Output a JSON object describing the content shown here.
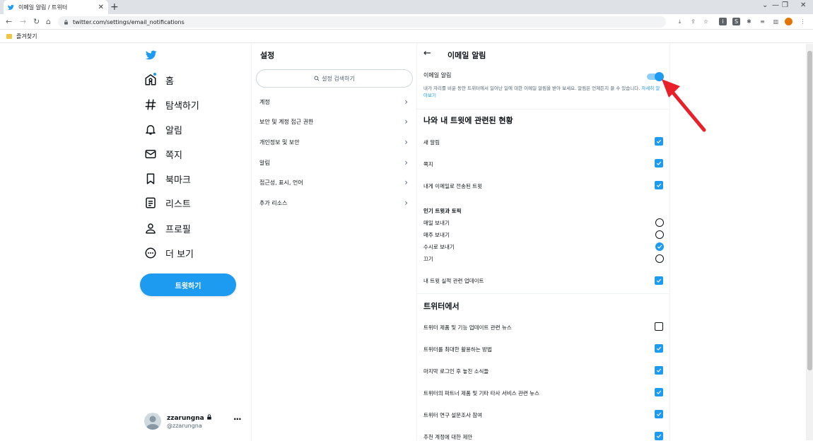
{
  "browser": {
    "tab_title": "이메일 알림 / 트위터",
    "tab_close": "✕",
    "new_tab": "+",
    "url": "twitter.com/settings/email_notifications",
    "bookmark_folder": "즐겨찾기",
    "window_controls": [
      "⌄",
      "—",
      "❐",
      "✕"
    ]
  },
  "nav": {
    "items": [
      {
        "label": "홈",
        "icon": "home-icon"
      },
      {
        "label": "탐색하기",
        "icon": "hashtag-icon"
      },
      {
        "label": "알림",
        "icon": "bell-icon"
      },
      {
        "label": "쪽지",
        "icon": "envelope-icon"
      },
      {
        "label": "북마크",
        "icon": "bookmark-icon"
      },
      {
        "label": "리스트",
        "icon": "list-icon"
      },
      {
        "label": "프로필",
        "icon": "person-icon"
      },
      {
        "label": "더 보기",
        "icon": "more-circle-icon"
      }
    ],
    "tweet_button": "트윗하기",
    "account": {
      "name": "zzarungna",
      "handle": "@zzarungna",
      "more": "···"
    }
  },
  "settings": {
    "title": "설정",
    "search_placeholder": "설정 검색하기",
    "items": [
      "계정",
      "보안 및 계정 접근 권한",
      "개인정보 및 보안",
      "알림",
      "접근성, 표시, 언어",
      "추가 리소스"
    ]
  },
  "email_notifications": {
    "title": "이메일 알림",
    "master_label": "이메일 알림",
    "master_enabled": true,
    "master_description": "내가 자리를 비운 동안 트위터에서 일어난 일에 대한 이메일 알림을 받아 보세요. 알림은 언제든지 끌 수 있습니다.",
    "learn_more": "자세히 알아보기",
    "section_activity": {
      "title": "나와 내 트윗에 관련된 현황",
      "checkboxes": [
        {
          "label": "새 알림",
          "checked": true
        },
        {
          "label": "쪽지",
          "checked": true
        },
        {
          "label": "내게 이메일로 전송된 트윗",
          "checked": true
        }
      ],
      "top_tweets": {
        "title": "인기 트윗과 토픽",
        "options": [
          {
            "label": "매일 보내기",
            "selected": false
          },
          {
            "label": "매주 보내기",
            "selected": false
          },
          {
            "label": "수시로 보내기",
            "selected": true
          },
          {
            "label": "끄기",
            "selected": false
          }
        ]
      },
      "performance": {
        "label": "내 트윗 실적 관련 업데이트",
        "checked": true
      }
    },
    "section_twitter": {
      "title": "트위터에서",
      "checkboxes": [
        {
          "label": "트위터 제품 및 기능 업데이트 관련 뉴스",
          "checked": false
        },
        {
          "label": "트위터를 최대한 활용하는 방법",
          "checked": true
        },
        {
          "label": "마지막 로그인 후 놓친 소식들",
          "checked": true
        },
        {
          "label": "트위터의 파트너 제품 및 기타 타사 서비스 관련 뉴스",
          "checked": true
        },
        {
          "label": "트위터 연구 설문조사 참여",
          "checked": true
        },
        {
          "label": "추천 계정에 대한 제안",
          "checked": true
        }
      ]
    }
  },
  "colors": {
    "accent": "#1d9bf0",
    "annotation": "#e8202a"
  }
}
